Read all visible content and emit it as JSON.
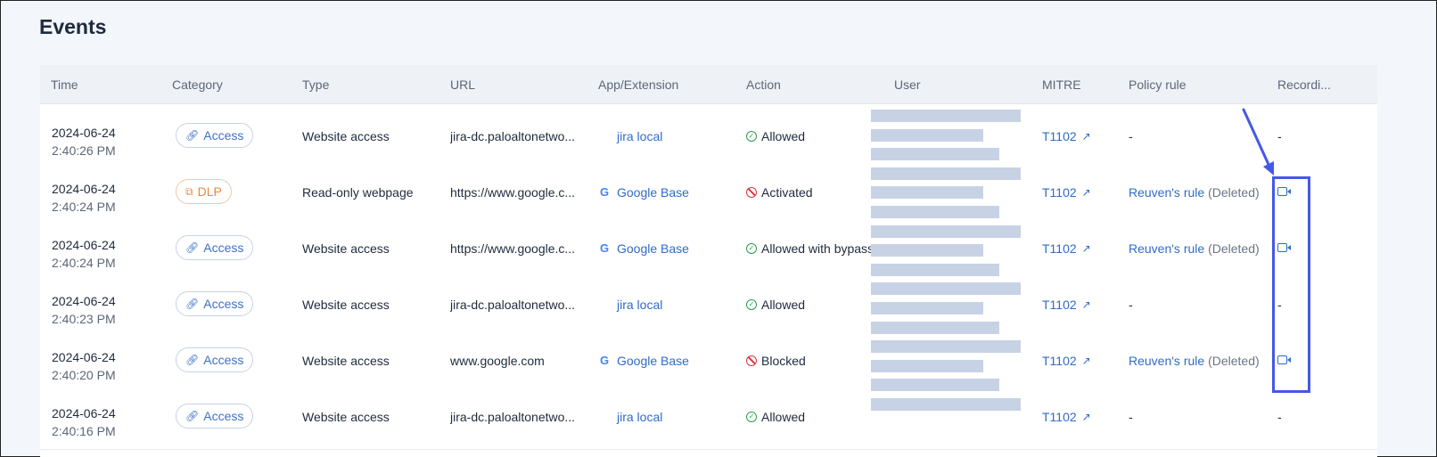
{
  "page": {
    "title": "Events"
  },
  "columns": [
    "Time",
    "Category",
    "Type",
    "URL",
    "App/Extension",
    "Action",
    "User",
    "MITRE",
    "Policy rule",
    "Recordi..."
  ],
  "rows": [
    {
      "date": "2024-06-24",
      "time": "2:40:26 PM",
      "category": "Access",
      "type": "Website access",
      "url": "jira-dc.paloaltonetwo...",
      "app": "jira local",
      "app_icon": "none",
      "action": "Allowed",
      "action_status": "allowed",
      "mitre": "T1102",
      "policy_rule": "-",
      "policy_deleted": "",
      "recording": "-"
    },
    {
      "date": "2024-06-24",
      "time": "2:40:24 PM",
      "category": "DLP",
      "type": "Read-only webpage",
      "url": "https://www.google.c...",
      "app": "Google Base",
      "app_icon": "google-icon",
      "action": "Activated",
      "action_status": "blocked",
      "mitre": "T1102",
      "policy_rule": "Reuven's rule",
      "policy_deleted": "(Deleted)",
      "recording": "video-icon"
    },
    {
      "date": "2024-06-24",
      "time": "2:40:24 PM",
      "category": "Access",
      "type": "Website access",
      "url": "https://www.google.c...",
      "app": "Google Base",
      "app_icon": "google-icon",
      "action": "Allowed with bypass",
      "action_status": "allowed",
      "mitre": "T1102",
      "policy_rule": "Reuven's rule",
      "policy_deleted": "(Deleted)",
      "recording": "video-icon"
    },
    {
      "date": "2024-06-24",
      "time": "2:40:23 PM",
      "category": "Access",
      "type": "Website access",
      "url": "jira-dc.paloaltonetwo...",
      "app": "jira local",
      "app_icon": "none",
      "action": "Allowed",
      "action_status": "allowed",
      "mitre": "T1102",
      "policy_rule": "-",
      "policy_deleted": "",
      "recording": "-"
    },
    {
      "date": "2024-06-24",
      "time": "2:40:20 PM",
      "category": "Access",
      "type": "Website access",
      "url": "www.google.com",
      "app": "Google Base",
      "app_icon": "google-icon",
      "action": "Blocked",
      "action_status": "blocked",
      "mitre": "T1102",
      "policy_rule": "Reuven's rule",
      "policy_deleted": "(Deleted)",
      "recording": "video-icon"
    },
    {
      "date": "2024-06-24",
      "time": "2:40:16 PM",
      "category": "Access",
      "type": "Website access",
      "url": "jira-dc.paloaltonetwo...",
      "app": "jira local",
      "app_icon": "none",
      "action": "Allowed",
      "action_status": "allowed",
      "mitre": "T1102",
      "policy_rule": "-",
      "policy_deleted": "",
      "recording": "-"
    }
  ],
  "colors": {
    "link": "#2f6bc7",
    "allowed": "#2e9a4e",
    "blocked": "#d9363e",
    "dlp": "#e88a3c",
    "highlight": "#4458e8",
    "redaction": "#c7d2e4"
  },
  "icons": {
    "access": "link-icon",
    "dlp": "copy-icon",
    "external": "external-link-icon",
    "recording": "video-icon"
  }
}
